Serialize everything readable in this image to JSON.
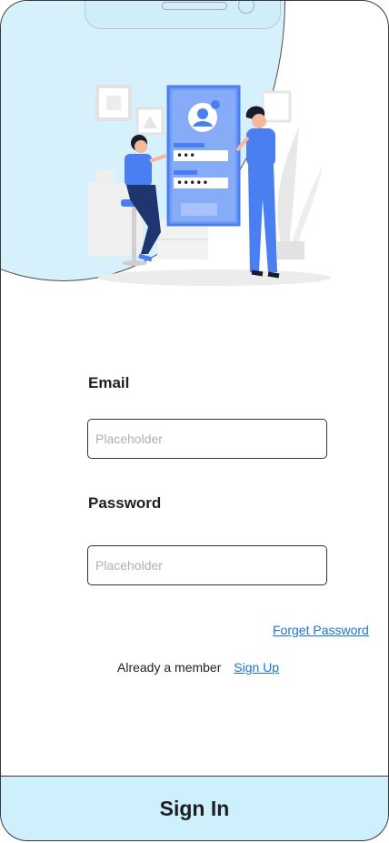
{
  "form": {
    "email_label": "Email",
    "email_placeholder": "Placeholder",
    "email_value": "",
    "password_label": "Password",
    "password_placeholder": "Placeholder",
    "password_value": "",
    "forget_password": "Forget Password",
    "member_text": "Already a member",
    "signup_link": "Sign Up",
    "signin_button": "Sign In"
  },
  "illustration": {
    "password_dots_1": "•••",
    "password_dots_2": "•••••"
  },
  "colors": {
    "accent_blue": "#4a7ff2",
    "bubble": "#d6f1fb",
    "signin_bg": "#cdf0fc",
    "link": "#1a73d8"
  }
}
